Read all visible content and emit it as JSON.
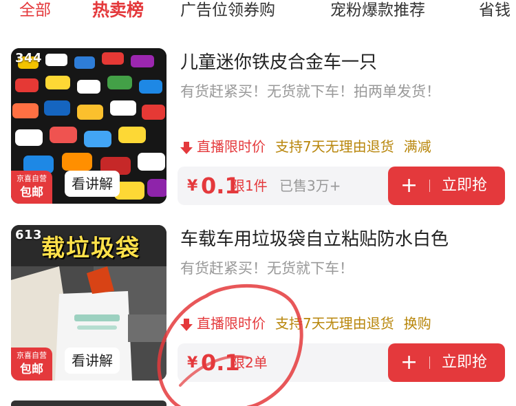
{
  "tabs": [
    {
      "label": "全部"
    },
    {
      "label": "热卖榜"
    },
    {
      "label": "广告位领券购"
    },
    {
      "label": "宠粉爆款推荐"
    },
    {
      "label": "省钱"
    }
  ],
  "products": [
    {
      "count": "344",
      "badge_line1": "京喜自营",
      "badge_line2": "包邮",
      "explain": "看讲解",
      "title": "儿童迷你铁皮合金车一只",
      "subtitle": "有货赶紧买！无货就下车！拍两单发货！",
      "promo_live": "直播限时价",
      "promo_tag1": "支持7天无理由退货",
      "promo_tag2": "满减",
      "price_symbol": "¥",
      "price": "0.1",
      "limit": "限1件",
      "sold": "已售3万+",
      "buy_plus": "+",
      "buy_label": "立即抢"
    },
    {
      "count": "613",
      "thumb_banner": "载垃圾袋",
      "badge_line1": "京喜自营",
      "badge_line2": "包邮",
      "explain": "看讲解",
      "title": "车载车用垃圾袋自立粘贴防水白色",
      "subtitle": "有货赶紧买！无货就下车！",
      "promo_live": "直播限时价",
      "promo_tag1": "支持7天无理由退货",
      "promo_tag2": "换购",
      "price_symbol": "¥",
      "price": "0.1",
      "limit": "限2单",
      "sold": "",
      "buy_plus": "+",
      "buy_label": "立即抢"
    }
  ],
  "colors": {
    "accent": "#e4393c",
    "gold_tag": "#b8860b",
    "muted": "#999999"
  },
  "icons": {
    "promo_arrow": "down-arrow-icon",
    "plus": "plus-icon"
  }
}
